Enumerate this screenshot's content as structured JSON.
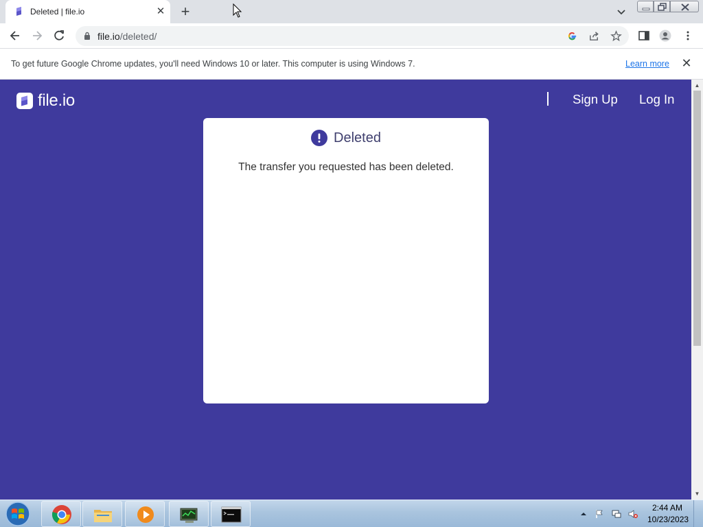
{
  "browser": {
    "tab": {
      "title": "Deleted | file.io",
      "favicon": "file-io-favicon"
    },
    "new_tab_icon": "plus-icon",
    "address": {
      "host": "file.io",
      "path": "/deleted/"
    },
    "toolbar_icons": [
      "back-icon",
      "forward-icon",
      "reload-icon",
      "lock-icon",
      "google-icon",
      "share-icon",
      "star-icon",
      "side-panel-icon",
      "profile-icon",
      "menu-icon"
    ]
  },
  "infobar": {
    "message": "To get future Google Chrome updates, you'll need Windows 10 or later. This computer is using Windows 7.",
    "link": "Learn more"
  },
  "site": {
    "logo_text": "file.io",
    "nav": {
      "signup": "Sign Up",
      "login": "Log In"
    },
    "brand_color": "#3f3a9d"
  },
  "card": {
    "title": "Deleted",
    "message": "The transfer you requested has been deleted."
  },
  "taskbar": {
    "apps": [
      "chrome-icon",
      "file-explorer-icon",
      "media-player-icon",
      "network-monitor-icon",
      "command-prompt-icon"
    ],
    "time": "2:44 AM",
    "date": "10/23/2023"
  }
}
